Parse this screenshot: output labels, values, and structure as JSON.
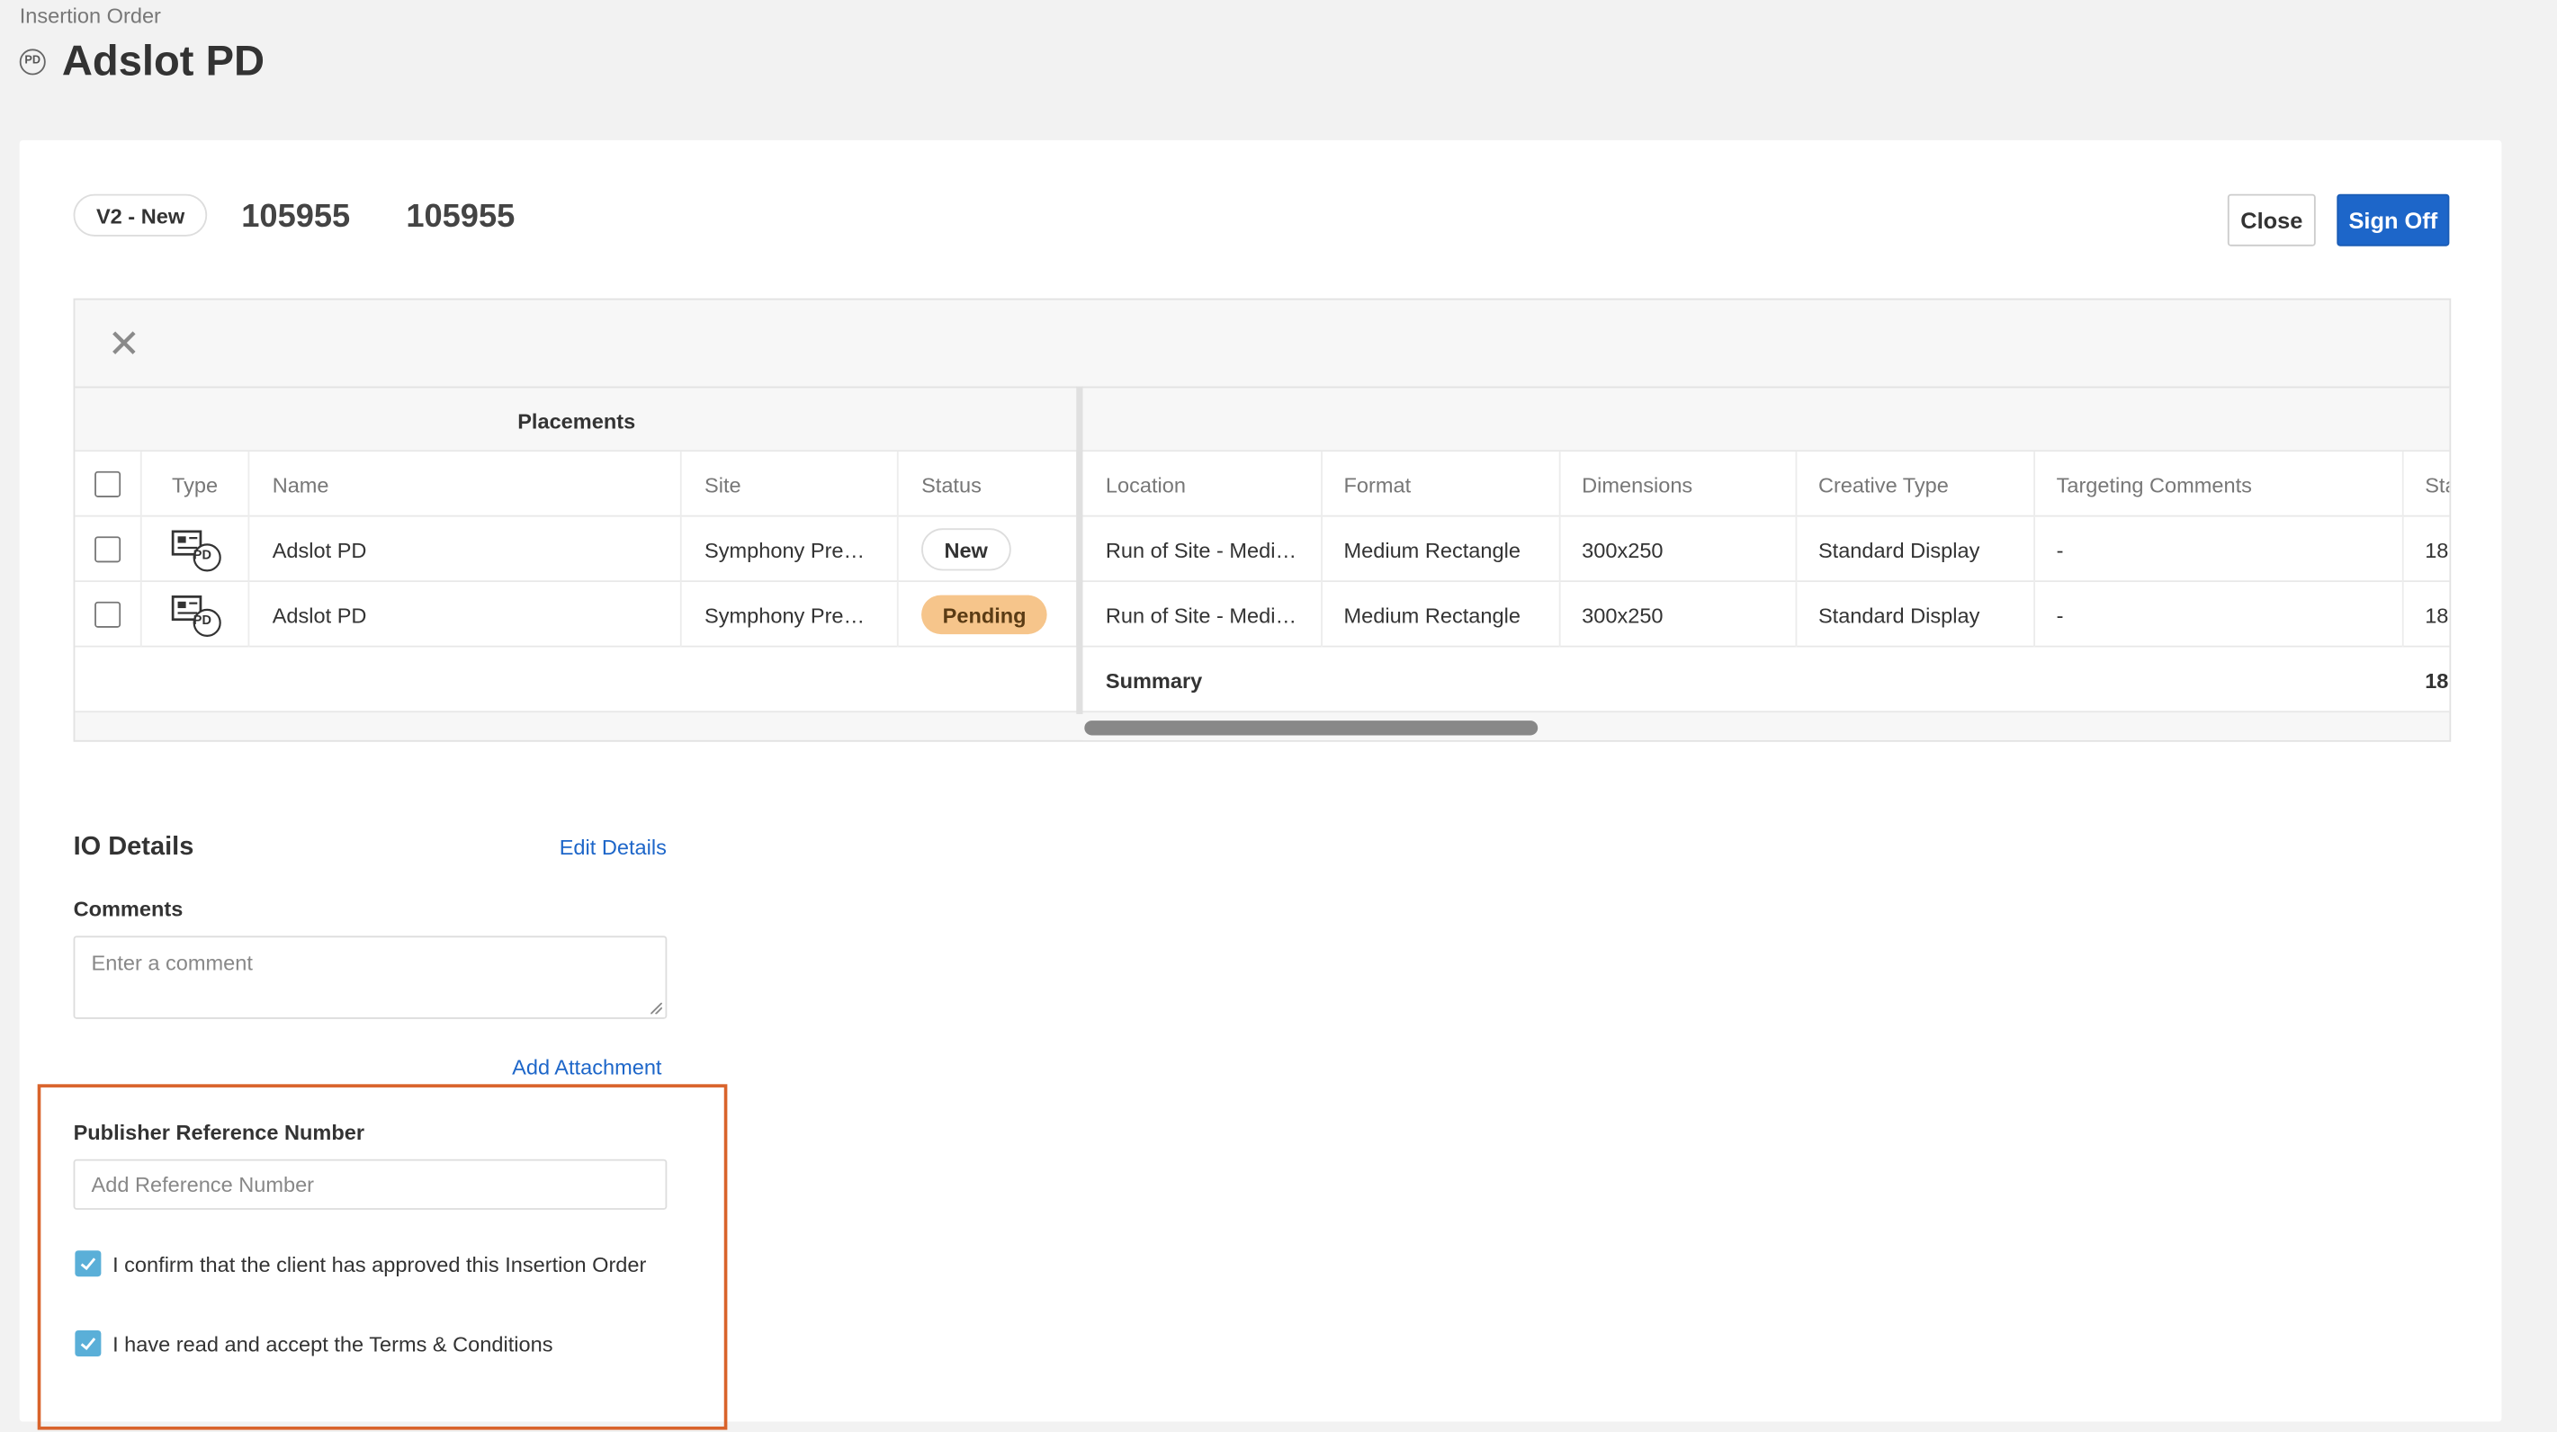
{
  "breadcrumb": "Insertion Order",
  "page_title": "Adslot PD",
  "page_badge": "PD",
  "version_pill": "V2 - New",
  "io_numbers": [
    "105955",
    "105955"
  ],
  "buttons": {
    "close": "Close",
    "sign_off": "Sign Off"
  },
  "grid": {
    "group_header": "Placements",
    "columns": [
      "Type",
      "Name",
      "Site",
      "Status",
      "Location",
      "Format",
      "Dimensions",
      "Creative Type",
      "Targeting Comments",
      "Sta"
    ],
    "rows": [
      {
        "type_badge": "PD",
        "name": "Adslot PD",
        "site": "Symphony Pre…",
        "status": "New",
        "location": "Run of Site - Medi…",
        "format": "Medium Rectangle",
        "dimensions": "300x250",
        "creative_type": "Standard Display",
        "targeting": "-",
        "extra": "18"
      },
      {
        "type_badge": "PD",
        "name": "Adslot PD",
        "site": "Symphony Pre…",
        "status": "Pending",
        "location": "Run of Site - Medi…",
        "format": "Medium Rectangle",
        "dimensions": "300x250",
        "creative_type": "Standard Display",
        "targeting": "-",
        "extra": "18"
      }
    ],
    "summary_label": "Summary",
    "summary_value": "18",
    "scroll_position": 0
  },
  "io_details": {
    "title": "IO Details",
    "edit_link": "Edit Details",
    "comments_label": "Comments",
    "comments_placeholder": "Enter a comment",
    "add_attachment": "Add Attachment",
    "publisher_ref_label": "Publisher Reference Number",
    "publisher_ref_placeholder": "Add Reference Number",
    "confirm_client": "I confirm that the client has approved this Insertion Order",
    "accept_terms": "I have read and accept the Terms & Conditions"
  },
  "colors": {
    "accent": "#1d66c9",
    "pending": "#f6c58b",
    "checkbox": "#5aafd8",
    "highlight": "#d9632b"
  }
}
